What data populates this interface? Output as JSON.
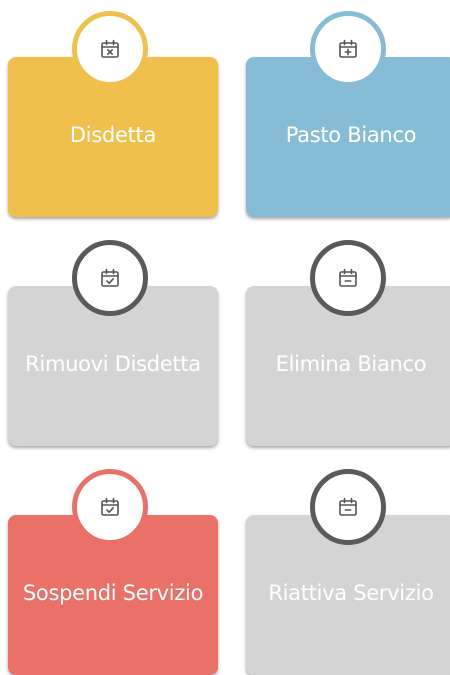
{
  "buttons": [
    {
      "label": "Disdetta",
      "icon": "calendar-x-icon",
      "color": "#f1bf4c"
    },
    {
      "label": "Pasto Bianco",
      "icon": "calendar-plus-icon",
      "color": "#87bcd6"
    },
    {
      "label": "Rimuovi Disdetta",
      "icon": "calendar-check-icon",
      "color": "#d4d4d4",
      "ring_color": "#5a5a5a"
    },
    {
      "label": "Elimina Bianco",
      "icon": "calendar-minus-icon",
      "color": "#d4d4d4",
      "ring_color": "#5a5a5a"
    },
    {
      "label": "Sospendi Servizio",
      "icon": "calendar-check-icon",
      "color": "#ea7168"
    },
    {
      "label": "Riattiva Servizio",
      "icon": "calendar-minus-icon",
      "color": "#d4d4d4",
      "ring_color": "#5a5a5a"
    }
  ]
}
